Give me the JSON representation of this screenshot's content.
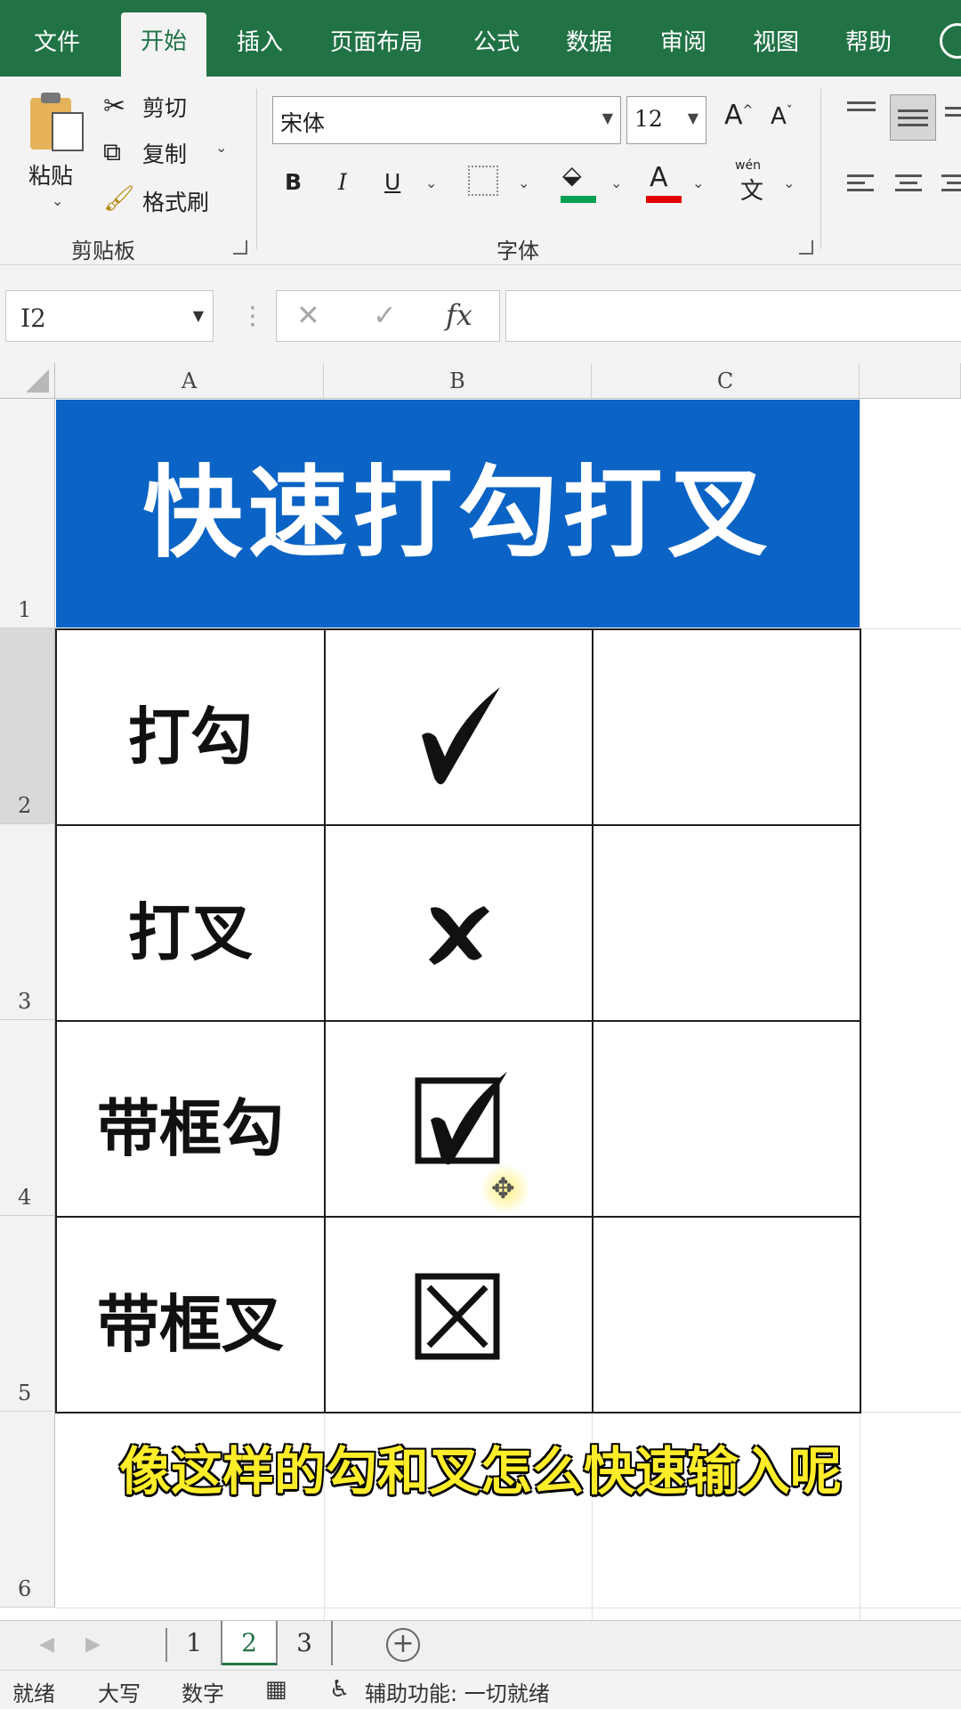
{
  "menu": {
    "tabs": [
      "文件",
      "开始",
      "插入",
      "页面布局",
      "公式",
      "数据",
      "审阅",
      "视图",
      "帮助"
    ],
    "active_index": 1
  },
  "ribbon": {
    "clipboard": {
      "paste": "粘贴",
      "cut": "剪切",
      "copy": "复制",
      "format_painter": "格式刷",
      "group_label": "剪贴板"
    },
    "font": {
      "font_name": "宋体",
      "font_size": "12",
      "group_label": "字体",
      "bold": "B",
      "italic": "I",
      "underline": "U",
      "font_color_glyph": "A",
      "grow_font": "A",
      "shrink_font": "A",
      "phonetic_top": "wén",
      "phonetic_char": "文",
      "fill_color": "#00a050",
      "font_color": "#e00000"
    }
  },
  "formula_bar": {
    "name_box": "I2",
    "cancel": "✕",
    "enter": "✓",
    "fx": "fx",
    "formula": ""
  },
  "grid": {
    "columns": [
      "A",
      "B",
      "C"
    ],
    "rows": [
      "1",
      "2",
      "3",
      "4",
      "5",
      "6"
    ],
    "selected_row": "2",
    "title": "快速打勾打叉",
    "title_color": "#0b63c5",
    "items": [
      {
        "label": "打勾",
        "symbol": "check"
      },
      {
        "label": "打叉",
        "symbol": "cross"
      },
      {
        "label": "带框勾",
        "symbol": "boxed-check"
      },
      {
        "label": "带框叉",
        "symbol": "boxed-cross"
      }
    ]
  },
  "caption": "像这样的勾和叉怎么快速输入呢",
  "sheets": {
    "tabs": [
      "1",
      "2",
      "3"
    ],
    "active_index": 1,
    "add": "+"
  },
  "status": {
    "ready": "就绪",
    "caps": "大写",
    "num": "数字",
    "accessibility": "辅助功能: 一切就绪"
  }
}
